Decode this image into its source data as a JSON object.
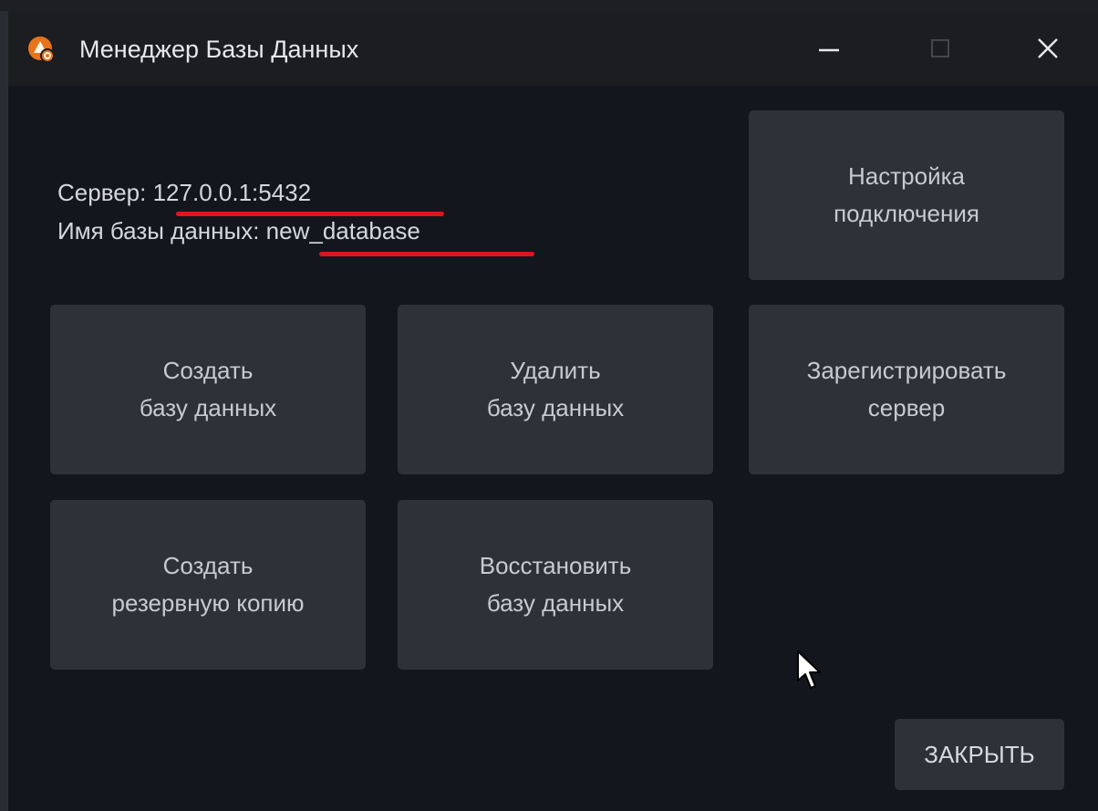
{
  "window": {
    "title": "Менеджер Базы Данных"
  },
  "titlebar_icons": {
    "app": "database-app-icon",
    "minimize": "minimize-icon",
    "maximize": "maximize-icon",
    "close": "close-icon"
  },
  "info": {
    "server_label": "Сервер: ",
    "server_value": "127.0.0.1:5432",
    "db_label": "Имя базы данных: ",
    "db_value": "new_database"
  },
  "buttons": {
    "connection_settings": {
      "line1": "Настройка",
      "line2": "подключения"
    },
    "create_db": {
      "line1": "Создать",
      "line2": "базу данных"
    },
    "delete_db": {
      "line1": "Удалить",
      "line2": "базу данных"
    },
    "register_server": {
      "line1": "Зарегистрировать",
      "line2": "сервер"
    },
    "create_backup": {
      "line1": "Создать",
      "line2": "резервную копию"
    },
    "restore_db": {
      "line1": "Восстановить",
      "line2": "базу данных"
    },
    "close": "ЗАКРЫТЬ"
  },
  "colors": {
    "window_bg": "#14161e",
    "titlebar_bg": "#1b1d20",
    "tile_bg": "#2f3139",
    "accent_underline": "#e0151c",
    "app_icon": "#e8731a"
  }
}
